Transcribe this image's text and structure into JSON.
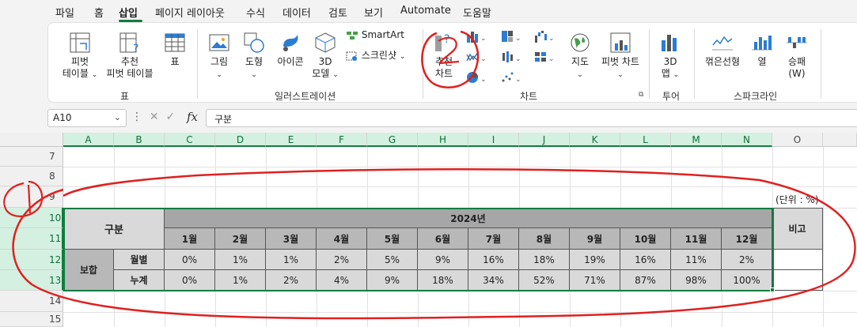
{
  "ribbon_tabs": [
    "파일",
    "홈",
    "삽입",
    "페이지 레이아웃",
    "수식",
    "데이터",
    "검토",
    "보기",
    "Automate",
    "도움말"
  ],
  "active_tab": "삽입",
  "ribbon": {
    "table_group": {
      "label": "표",
      "pivot_line1": "피벗",
      "pivot_line2": "테이블",
      "recommended_line1": "추천",
      "recommended_line2": "피벗 테이블",
      "table": "표"
    },
    "illustrations_group": {
      "label": "일러스트레이션",
      "picture": "그림",
      "shapes": "도형",
      "icons": "아이콘",
      "model_line1": "3D",
      "model_line2": "모델",
      "smartart": "SmartArt",
      "screenshot": "스크린샷"
    },
    "charts_group": {
      "label": "차트",
      "recommended_line1": "추천",
      "recommended_line2": "차트",
      "map": "지도",
      "pivot_chart": "피벗 차트"
    },
    "tours_group": {
      "label": "투어",
      "map3d_line1": "3D",
      "map3d_line2": "맵"
    },
    "sparklines_group": {
      "label": "스파크라인",
      "line": "꺾은선형",
      "column": "열",
      "winloss_line1": "승패",
      "winloss_line2": "(W)"
    }
  },
  "formula_bar": {
    "name_box": "A10",
    "content": "구분"
  },
  "columns": [
    "A",
    "B",
    "C",
    "D",
    "E",
    "F",
    "G",
    "H",
    "I",
    "J",
    "K",
    "L",
    "M",
    "N",
    "O"
  ],
  "rows": [
    "7",
    "8",
    "9",
    "10",
    "11",
    "12",
    "13",
    "14",
    "15"
  ],
  "table": {
    "unit_note": "(단위 : %)",
    "header_category": "구분",
    "header_year": "2024년",
    "header_note": "비고",
    "months": [
      "1월",
      "2월",
      "3월",
      "4월",
      "5월",
      "6월",
      "7월",
      "8월",
      "9월",
      "10월",
      "11월",
      "12월"
    ],
    "group_label": "보합",
    "monthly_label": "월별",
    "cumulative_label": "누계",
    "monthly_values": [
      "0%",
      "1%",
      "1%",
      "2%",
      "5%",
      "9%",
      "16%",
      "18%",
      "19%",
      "16%",
      "11%",
      "2%"
    ],
    "cumulative_values": [
      "0%",
      "1%",
      "2%",
      "4%",
      "9%",
      "18%",
      "34%",
      "52%",
      "71%",
      "87%",
      "98%",
      "100%"
    ]
  },
  "annotations": {
    "circle_label_1": "1",
    "circle_label_2": "2"
  },
  "colors": {
    "accent": "#107c41",
    "annotation_red": "#e02020",
    "header_dark_gray": "#a6a6a6",
    "header_gray": "#c8c8c8"
  }
}
